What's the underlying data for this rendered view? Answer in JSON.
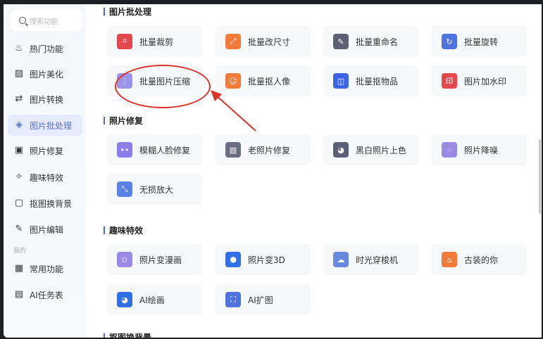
{
  "search": {
    "placeholder": "搜索功能"
  },
  "sidebar": {
    "items": [
      {
        "label": "热门功能",
        "icon": "fire-icon",
        "glyph": "♨"
      },
      {
        "label": "图片美化",
        "icon": "image-beauty-icon",
        "glyph": "▨"
      },
      {
        "label": "图片转换",
        "icon": "convert-icon",
        "glyph": "⇄"
      },
      {
        "label": "图片批处理",
        "icon": "batch-icon",
        "glyph": "◈",
        "active": true
      },
      {
        "label": "照片修复",
        "icon": "photo-repair-icon",
        "glyph": "▣"
      },
      {
        "label": "趣味特效",
        "icon": "magic-wand-icon",
        "glyph": "✧"
      },
      {
        "label": "抠图换背景",
        "icon": "cutout-icon",
        "glyph": "▢"
      },
      {
        "label": "图片编辑",
        "icon": "edit-image-icon",
        "glyph": "✎"
      }
    ],
    "group_label": "我的",
    "my_items": [
      {
        "label": "常用功能",
        "icon": "grid-icon",
        "glyph": "▦"
      },
      {
        "label": "AI任务表",
        "icon": "document-icon",
        "glyph": "▤"
      }
    ]
  },
  "sections": [
    {
      "title": "图片批处理",
      "cards": [
        {
          "label": "批量裁剪",
          "icon": "crop-icon",
          "color": "#e4474c",
          "glyph": "⌗"
        },
        {
          "label": "批量改尺寸",
          "icon": "resize-icon",
          "color": "#f27b3a",
          "glyph": "⤢"
        },
        {
          "label": "批量重命名",
          "icon": "rename-icon",
          "color": "#5d5f73",
          "glyph": "✎"
        },
        {
          "label": "批量旋转",
          "icon": "rotate-icon",
          "color": "#4f74e0",
          "glyph": "↻"
        },
        {
          "label": "批量图片压缩",
          "icon": "compress-icon",
          "color": "#9b95e8",
          "glyph": "⋮"
        },
        {
          "label": "批量抠人像",
          "icon": "portrait-cutout-icon",
          "color": "#f27b3a",
          "glyph": "☺"
        },
        {
          "label": "批量抠物品",
          "icon": "object-cutout-icon",
          "color": "#3b63e3",
          "glyph": "◫"
        },
        {
          "label": "图片加水印",
          "icon": "watermark-icon",
          "color": "#e4474c",
          "glyph": "印"
        }
      ]
    },
    {
      "title": "照片修复",
      "cards": [
        {
          "label": "模糊人脸修复",
          "icon": "face-repair-icon",
          "color": "#8c7ee8",
          "glyph": "••"
        },
        {
          "label": "老照片修复",
          "icon": "old-photo-icon",
          "color": "#6a6d80",
          "glyph": "▨"
        },
        {
          "label": "黑白照片上色",
          "icon": "palette-icon",
          "color": "#5c5f78",
          "glyph": "◕"
        },
        {
          "label": "照片降噪",
          "icon": "denoise-icon",
          "color": "#9a8ae6",
          "glyph": "⁘"
        },
        {
          "label": "无损放大",
          "icon": "upscale-icon",
          "color": "#5a82e6",
          "glyph": "⤡"
        }
      ]
    },
    {
      "title": "趣味特效",
      "cards": [
        {
          "label": "照片变漫画",
          "icon": "comic-icon",
          "color": "#9a8ae6",
          "glyph": "✩"
        },
        {
          "label": "照片变3D",
          "icon": "cube-icon",
          "color": "#2f6fe8",
          "glyph": "⬢"
        },
        {
          "label": "时光穿梭机",
          "icon": "time-machine-icon",
          "color": "#6a88e0",
          "glyph": "☁"
        },
        {
          "label": "古装的你",
          "icon": "ancient-house-icon",
          "color": "#f27b3a",
          "glyph": "⌂"
        },
        {
          "label": "AI绘画",
          "icon": "ai-paint-icon",
          "color": "#2f6fe8",
          "glyph": "◕"
        },
        {
          "label": "AI扩图",
          "icon": "expand-image-icon",
          "color": "#4f74e0",
          "glyph": "⛶"
        }
      ]
    },
    {
      "title": "抠图换背景",
      "cards": []
    }
  ],
  "annotation": {
    "color": "#d9332b"
  }
}
